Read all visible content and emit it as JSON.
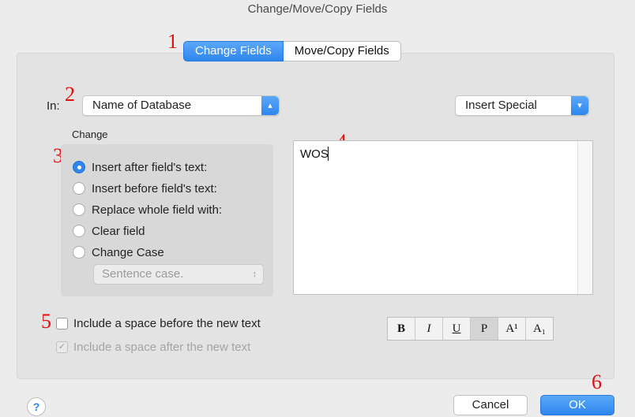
{
  "window": {
    "title": "Change/Move/Copy Fields"
  },
  "tabs": [
    {
      "label": "Change Fields"
    },
    {
      "label": "Move/Copy Fields"
    }
  ],
  "in_row": {
    "label": "In:",
    "field_value": "Name of Database",
    "insert_special": "Insert Special"
  },
  "change_group": {
    "label": "Change",
    "options": [
      {
        "label": "Insert after field's text:",
        "selected": true
      },
      {
        "label": "Insert before field's text:",
        "selected": false
      },
      {
        "label": "Replace whole field with:",
        "selected": false
      },
      {
        "label": "Clear field",
        "selected": false
      },
      {
        "label": "Change Case",
        "selected": false
      }
    ],
    "case_value": "Sentence case."
  },
  "text_area": {
    "value": "WOS"
  },
  "checkboxes": {
    "space_before": "Include a space before the new text",
    "space_after": "Include a space after the new text"
  },
  "format_buttons": [
    "B",
    "I",
    "U",
    "P",
    "A¹",
    "A₁"
  ],
  "footer": {
    "cancel": "Cancel",
    "ok": "OK",
    "help": "?"
  },
  "annotations": [
    "1",
    "2",
    "3",
    "4",
    "5",
    "6"
  ],
  "colors": {
    "accent": "#2e86ee",
    "annotation": "#e01010"
  }
}
